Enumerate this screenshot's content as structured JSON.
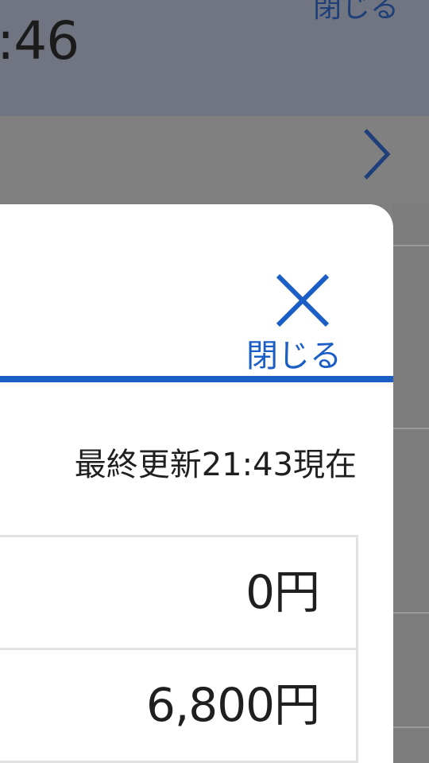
{
  "background": {
    "time_partial": ":46",
    "close_label": "閉じる",
    "chevron_icon": "chevron-right-icon"
  },
  "modal": {
    "close_icon": "close-x-icon",
    "close_label": "閉じる",
    "accent_color": "#1b5fc6",
    "updated_text": "最終更新21:43現在",
    "rows": [
      {
        "value": "0円"
      },
      {
        "value": "6,800円"
      }
    ]
  }
}
